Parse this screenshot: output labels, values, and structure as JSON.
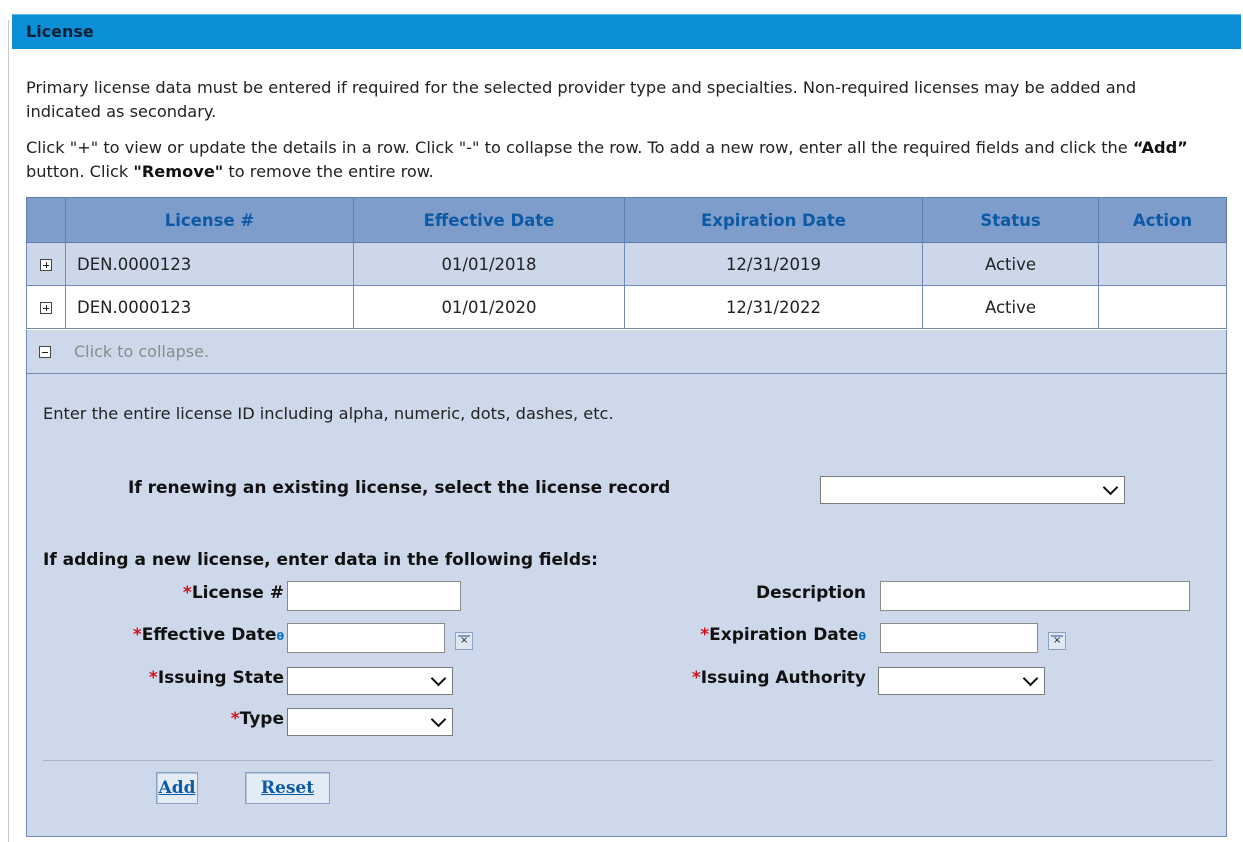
{
  "section": {
    "title": "License"
  },
  "intro": {
    "line1": "Primary license data must be entered if required for the selected provider type and specialties. Non-required licenses may be added and indicated as secondary.",
    "line2_a": "Click \"+\" to view or update the details in a row. Click \"-\" to collapse the row. To add a new row, enter all the required fields and click the ",
    "line2_add": "“Add”",
    "line2_b": " button. Click ",
    "line2_remove": "\"Remove\"",
    "line2_c": " to remove the entire row."
  },
  "table": {
    "headers": {
      "license": "License #",
      "effective": "Effective Date",
      "expiration": "Expiration Date",
      "status": "Status",
      "action": "Action"
    },
    "rows": [
      {
        "license": "DEN.0000123",
        "effective": "01/01/2018",
        "expiration": "12/31/2019",
        "status": "Active",
        "action": ""
      },
      {
        "license": "DEN.0000123",
        "effective": "01/01/2020",
        "expiration": "12/31/2022",
        "status": "Active",
        "action": ""
      }
    ],
    "collapse_label": "Click to collapse."
  },
  "form": {
    "hint": "Enter the entire license ID including alpha, numeric, dots, dashes, etc.",
    "renew_label": "If renewing an existing license, select the license record",
    "renew_value": "",
    "adding_label": "If adding a new license, enter data in the following fields:",
    "required_mark": "*",
    "info_mark": "θ",
    "license_label": "License #",
    "license_value": "",
    "description_label": "Description",
    "description_value": "",
    "effective_label": "Effective Date",
    "effective_value": "",
    "expiration_label": "Expiration Date",
    "expiration_value": "",
    "issuing_state_label": "Issuing State",
    "issuing_state_value": "",
    "issuing_authority_label": "Issuing Authority",
    "issuing_authority_value": "",
    "type_label": "Type",
    "type_value": ""
  },
  "buttons": {
    "add": "Add",
    "reset": "Reset"
  },
  "colors": {
    "header_bar": "#0b8fd6",
    "table_header": "#7f9dcb",
    "header_text": "#0c5aa6",
    "panel": "#cdd9ea",
    "required": "#d1111a"
  },
  "icons": {
    "expand": "plus-box-icon",
    "collapse": "minus-box-icon",
    "calendar": "calendar-icon",
    "dropdown": "chevron-down-icon"
  }
}
